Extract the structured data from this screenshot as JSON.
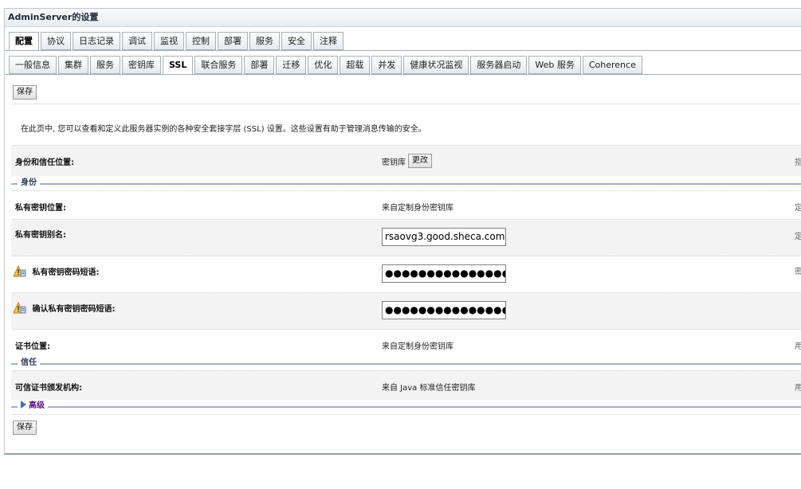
{
  "panel": {
    "title": "AdminServer的设置"
  },
  "tabs_primary": [
    {
      "label": "配置",
      "active": true
    },
    {
      "label": "协议"
    },
    {
      "label": "日志记录"
    },
    {
      "label": "调试"
    },
    {
      "label": "监视"
    },
    {
      "label": "控制"
    },
    {
      "label": "部署"
    },
    {
      "label": "服务"
    },
    {
      "label": "安全"
    },
    {
      "label": "注释"
    }
  ],
  "tabs_secondary": [
    {
      "label": "一般信息"
    },
    {
      "label": "集群"
    },
    {
      "label": "服务"
    },
    {
      "label": "密钥库"
    },
    {
      "label": "SSL",
      "active": true
    },
    {
      "label": "联合服务"
    },
    {
      "label": "部署"
    },
    {
      "label": "迁移"
    },
    {
      "label": "优化"
    },
    {
      "label": "超载"
    },
    {
      "label": "并发"
    },
    {
      "label": "健康状况监视"
    },
    {
      "label": "服务器启动"
    },
    {
      "label": "Web 服务"
    },
    {
      "label": "Coherence"
    }
  ],
  "buttons": {
    "save": "保存",
    "change": "更改"
  },
  "description": "在此页中, 您可以查看和定义此服务器实例的各种安全套接字层 (SSL) 设置。这些设置有助于管理消息传输的安全。",
  "identity_trust": {
    "label": "身份和信任位置:",
    "value": "密钥库",
    "hint": "指:"
  },
  "sections": {
    "identity": "身份",
    "trust": "信任",
    "advanced": "高级"
  },
  "private_key_location": {
    "label": "私有密钥位置:",
    "value": "来自定制身份密钥库",
    "hint": "定:"
  },
  "private_key_alias": {
    "label": "私有密钥别名:",
    "value": "rsaovg3.good.sheca.com",
    "hint": "定:"
  },
  "private_key_passphrase": {
    "label": "私有密钥密码短语:",
    "value": "●●●●●●●●●●●●●●●●●●",
    "hint": "密:"
  },
  "confirm_passphrase": {
    "label": "确认私有密钥密码短语:",
    "value": "●●●●●●●●●●●●●●●●●●"
  },
  "cert_location": {
    "label": "证书位置:",
    "value": "来自定制身份密钥库",
    "hint": "用:"
  },
  "trusted_ca": {
    "label": "可信证书颁发机构:",
    "value": "来自 Java 标准信任密钥库",
    "hint": "用:"
  },
  "icons": {
    "warning": "warning-lock-icon",
    "expand": "expand-triangle-icon"
  }
}
